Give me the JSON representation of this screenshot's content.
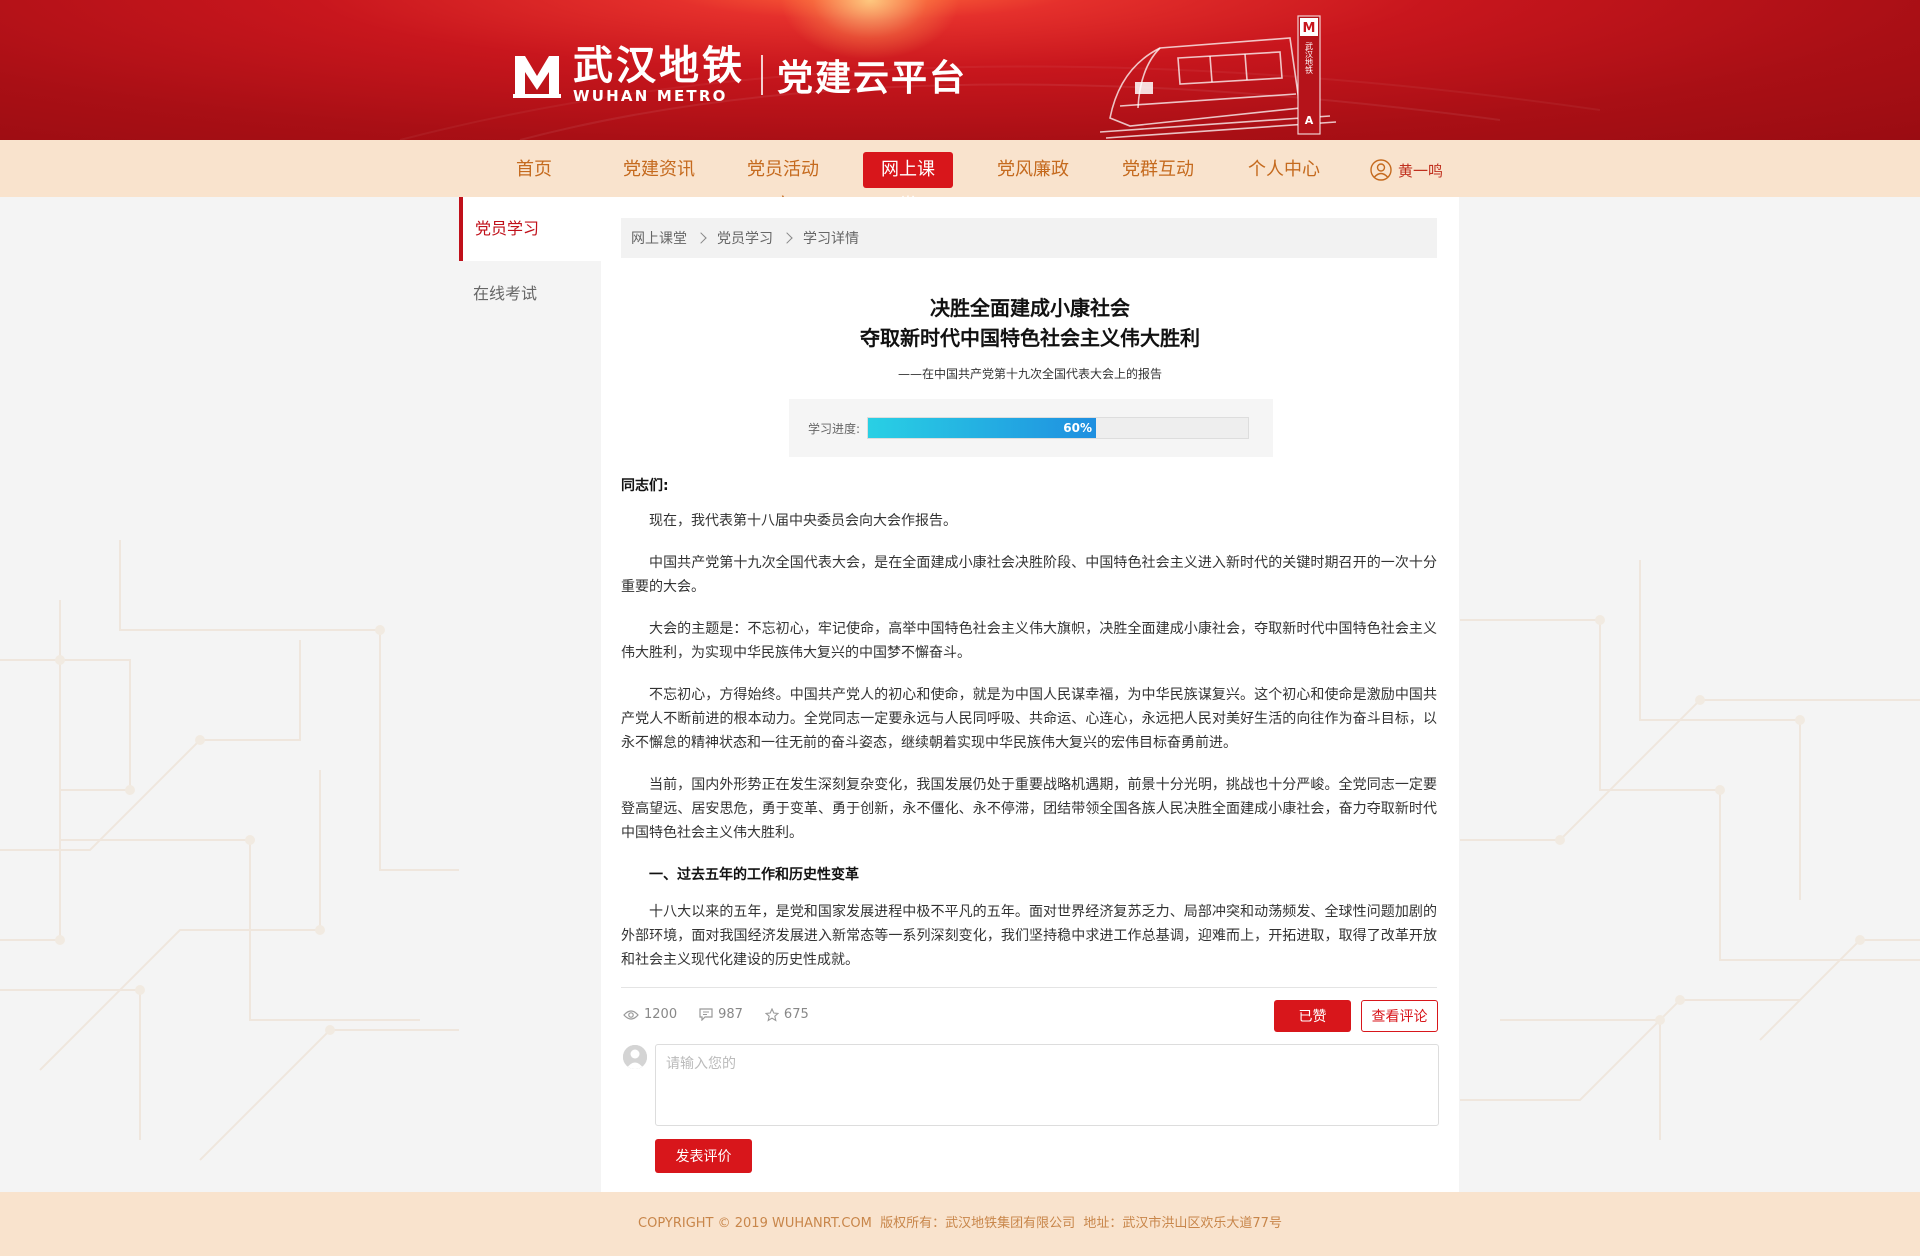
{
  "brand": {
    "name_cn": "武汉地铁",
    "name_en": "WUHAN METRO",
    "platform": "党建云平台",
    "logo_letter": "M",
    "sign_text": "武汉地铁",
    "sign_letter": "A",
    "primary_color": "#d8161b",
    "nav_bg": "#f9e3cd"
  },
  "nav": {
    "items": [
      {
        "label": "首页"
      },
      {
        "label": "党建资讯"
      },
      {
        "label": "党员活动室"
      },
      {
        "label": "网上课堂",
        "active": true
      },
      {
        "label": "党风廉政"
      },
      {
        "label": "党群互动"
      },
      {
        "label": "个人中心"
      }
    ],
    "user": {
      "icon": "user-circle-icon",
      "name": "黄一鸣"
    }
  },
  "sidebar": {
    "items": [
      {
        "label": "党员学习",
        "active": true
      },
      {
        "label": "在线考试"
      }
    ]
  },
  "breadcrumb": {
    "items": [
      "网上课堂",
      "党员学习",
      "学习详情"
    ]
  },
  "article": {
    "title_line1": "决胜全面建成小康社会",
    "title_line2": "夺取新时代中国特色社会主义伟大胜利",
    "subtitle": "——在中国共产党第十九次全国代表大会上的报告",
    "progress": {
      "label": "学习进度:",
      "percent": 60,
      "text": "60%"
    },
    "greeting": "同志们:",
    "paragraphs": [
      "现在，我代表第十八届中央委员会向大会作报告。",
      "中国共产党第十九次全国代表大会，是在全面建成小康社会决胜阶段、中国特色社会主义进入新时代的关键时期召开的一次十分重要的大会。",
      "大会的主题是：不忘初心，牢记使命，高举中国特色社会主义伟大旗帜，决胜全面建成小康社会，夺取新时代中国特色社会主义伟大胜利，为实现中华民族伟大复兴的中国梦不懈奋斗。",
      "不忘初心，方得始终。中国共产党人的初心和使命，就是为中国人民谋幸福，为中华民族谋复兴。这个初心和使命是激励中国共产党人不断前进的根本动力。全党同志一定要永远与人民同呼吸、共命运、心连心，永远把人民对美好生活的向往作为奋斗目标，以永不懈怠的精神状态和一往无前的奋斗姿态，继续朝着实现中华民族伟大复兴的宏伟目标奋勇前进。",
      "当前，国内外形势正在发生深刻复杂变化，我国发展仍处于重要战略机遇期，前景十分光明，挑战也十分严峻。全党同志一定要登高望远、居安思危，勇于变革、勇于创新，永不僵化、永不停滞，团结带领全国各族人民决胜全面建成小康社会，奋力夺取新时代中国特色社会主义伟大胜利。"
    ],
    "section_heading": "一、过去五年的工作和历史性变革",
    "section_paragraph": "十八大以来的五年，是党和国家发展进程中极不平凡的五年。面对世界经济复苏乏力、局部冲突和动荡频发、全球性问题加剧的外部环境，面对我国经济发展进入新常态等一系列深刻变化，我们坚持稳中求进工作总基调，迎难而上，开拓进取，取得了改革开放和社会主义现代化建设的历史性成就。"
  },
  "stats": {
    "views": "1200",
    "comments": "987",
    "favorites": "675"
  },
  "actions": {
    "liked_label": "已赞",
    "view_comments_label": "查看评论"
  },
  "comment": {
    "placeholder": "请输入您的",
    "submit_label": "发表评价"
  },
  "footer": {
    "text": "COPYRIGHT © 2019 WUHANRT.COM  版权所有：武汉地铁集团有限公司  地址：武汉市洪山区欢乐大道77号"
  }
}
